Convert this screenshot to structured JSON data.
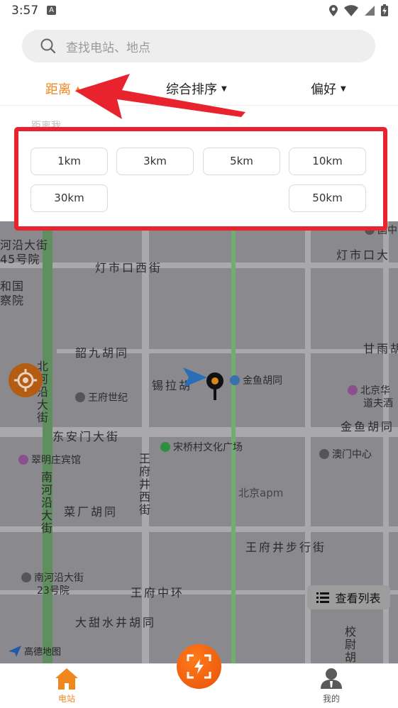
{
  "status_bar": {
    "time": "3:57",
    "notif_letter": "A"
  },
  "search": {
    "placeholder": "查找电站、地点"
  },
  "filters": {
    "distance": "距离",
    "sort": "综合排序",
    "preference": "偏好"
  },
  "distance_panel": {
    "label": "距离我",
    "options": [
      "1km",
      "3km",
      "5km",
      "10km",
      "30km",
      "50km"
    ]
  },
  "map": {
    "streets": [
      "灯市口西街",
      "灯市口大",
      "韶九胡同",
      "锡拉胡",
      "东安门大街",
      "菜厂胡同",
      "王府井步行街",
      "王府中环",
      "大甜水井胡同",
      "甘雨胡",
      "金鱼胡同"
    ],
    "vertical_streets": [
      "北河沿大街",
      "王府井西街",
      "南河沿大街",
      "校尉胡"
    ],
    "partial_left": [
      "河沿大街",
      "45号院",
      "和国",
      "察院"
    ],
    "pois": {
      "wangfu_shiji": "王府世纪",
      "jinyu_hutong": "金鱼胡同",
      "songqiaocun": "宋桥村文化广场",
      "cuiming": "翠明庄宾馆",
      "beijing_apm": "北京apm",
      "aomen": "澳门中心",
      "beijing_huaqiao": "北京华",
      "hotel_suffix": "道夫酒",
      "nanheyan": "南河沿大街",
      "nanheyan_num": "23号院",
      "top_right": "国中"
    },
    "list_button": "查看列表",
    "brand": "高德地图"
  },
  "tabbar": {
    "stations": "电站",
    "mine": "我的"
  },
  "colors": {
    "accent": "#f0861e",
    "highlight": "#e8232d",
    "scan": "#f06a10"
  }
}
